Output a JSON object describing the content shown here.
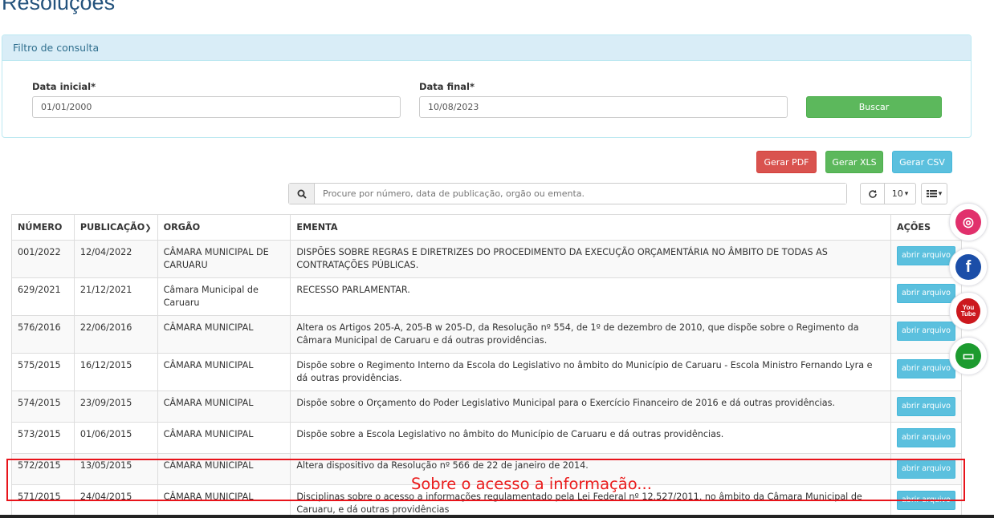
{
  "page": {
    "title": "Resoluções"
  },
  "filter": {
    "heading": "Filtro de consulta",
    "start_label": "Data inicial*",
    "start_value": "01/01/2000",
    "end_label": "Data final*",
    "end_value": "10/08/2023",
    "search_button": "Buscar"
  },
  "export": {
    "pdf": "Gerar PDF",
    "xls": "Gerar XLS",
    "csv": "Gerar CSV"
  },
  "search": {
    "placeholder": "Procure por número, data de publicação, orgão ou ementa.",
    "page_size": "10"
  },
  "table": {
    "headers": {
      "numero": "NÚMERO",
      "publicacao": "PUBLICAÇÃO",
      "orgao": "ORGÃO",
      "ementa": "EMENTA",
      "acoes": "AÇÕES"
    },
    "action_label": "abrir arquivo",
    "rows": [
      {
        "numero": "001/2022",
        "publicacao": "12/04/2022",
        "orgao": "CÂMARA MUNICIPAL DE CARUARU",
        "ementa": "DISPÕES SOBRE REGRAS E DIRETRIZES DO PROCEDIMENTO DA EXECUÇÃO ORÇAMENTÁRIA NO ÂMBITO DE TODAS AS CONTRATAÇÕES PÚBLICAS."
      },
      {
        "numero": "629/2021",
        "publicacao": "21/12/2021",
        "orgao": "Câmara Municipal de Caruaru",
        "ementa": "RECESSO PARLAMENTAR."
      },
      {
        "numero": "576/2016",
        "publicacao": "22/06/2016",
        "orgao": "CÂMARA MUNICIPAL",
        "ementa": "Altera os Artigos 205-A, 205-B w 205-D, da Resolução nº 554, de 1º de dezembro de 2010, que dispõe sobre o Regimento da Câmara Municipal de Caruaru e dá outras providências."
      },
      {
        "numero": "575/2015",
        "publicacao": "16/12/2015",
        "orgao": "CÂMARA MUNICIPAL",
        "ementa": "Dispõe sobre o Regimento Interno da Escola do Legislativo no âmbito do Município de Caruaru - Escola Ministro Fernando Lyra e dá outras providências."
      },
      {
        "numero": "574/2015",
        "publicacao": "23/09/2015",
        "orgao": "CÂMARA MUNICIPAL",
        "ementa": "Dispõe sobre o Orçamento do Poder Legislativo Municipal para o Exercício Financeiro de 2016 e dá outras providências."
      },
      {
        "numero": "573/2015",
        "publicacao": "01/06/2015",
        "orgao": "CÂMARA MUNICIPAL",
        "ementa": "Dispõe sobre a Escola Legislativo no âmbito do Município de Caruaru e dá outras providências."
      },
      {
        "numero": "572/2015",
        "publicacao": "13/05/2015",
        "orgao": "CÂMARA MUNICIPAL",
        "ementa": "Altera dispositivo da Resolução nº 566 de 22 de janeiro de 2014."
      },
      {
        "numero": "571/2015",
        "publicacao": "24/04/2015",
        "orgao": "CÂMARA MUNICIPAL",
        "ementa": "Disciplinas sobre o acesso a informações regulamentado pela Lei Federal nº 12.527/2011, no âmbito da Câmara Municipal de Caruaru, e dá outras providências"
      }
    ]
  },
  "annotation": {
    "text": "Sobre o acesso a informação..."
  },
  "social": {
    "items": [
      {
        "name": "instagram-icon",
        "color": "#e1306c",
        "glyph": "◎"
      },
      {
        "name": "facebook-icon",
        "color": "#1b4ea8",
        "glyph": "f"
      },
      {
        "name": "youtube-icon",
        "color": "#cc181e",
        "glyph": "You Tube"
      },
      {
        "name": "tv-icon",
        "color": "#1c9b2f",
        "glyph": "▭"
      }
    ]
  },
  "colors": {
    "danger": "#d9534f",
    "success": "#5cb85c",
    "info": "#5bc0de",
    "highlight": "#e8141b"
  }
}
